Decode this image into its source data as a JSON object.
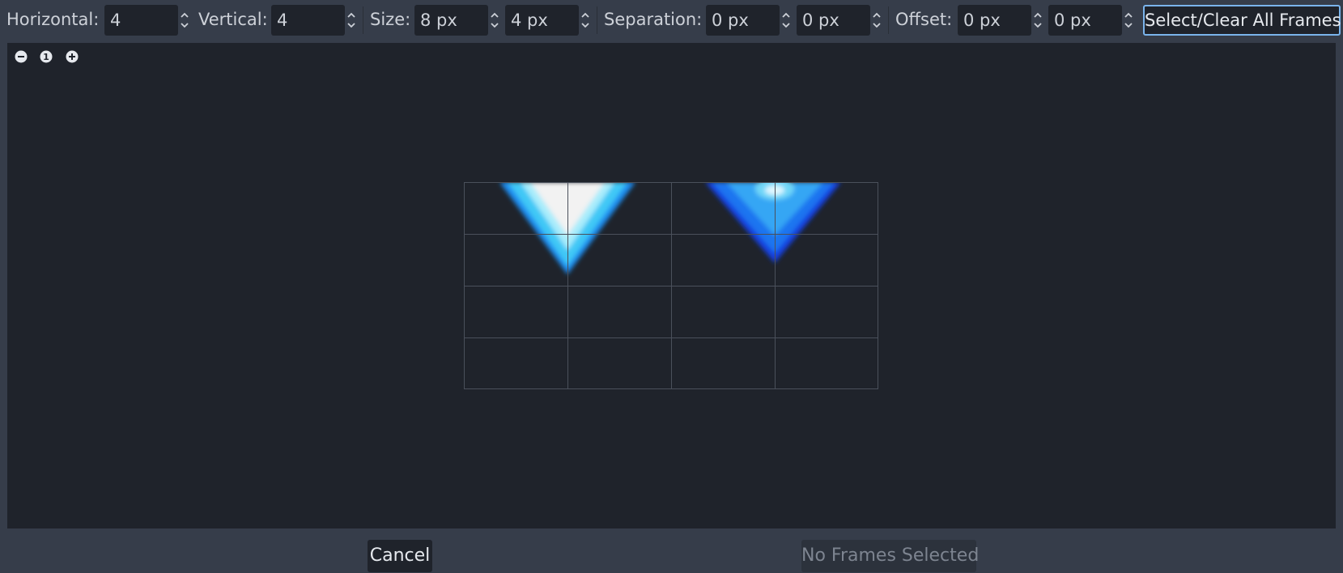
{
  "toolbar": {
    "horizontal_label": "Horizontal:",
    "horizontal_value": "4",
    "vertical_label": "Vertical:",
    "vertical_value": "4",
    "size_label": "Size:",
    "size_x_value": "8 px",
    "size_y_value": "4 px",
    "separation_label": "Separation:",
    "separation_x_value": "0 px",
    "separation_y_value": "0 px",
    "offset_label": "Offset:",
    "offset_x_value": "0 px",
    "offset_y_value": "0 px",
    "select_clear_label": "Select/Clear All Frames"
  },
  "zoom": {
    "zoom_out_icon": "zoom-out-icon",
    "zoom_reset_icon": "zoom-reset-icon",
    "zoom_reset_label": "1",
    "zoom_in_icon": "zoom-in-icon"
  },
  "grid": {
    "columns": 4,
    "rows": 4,
    "line_color": "#4a505b"
  },
  "footer": {
    "cancel_label": "Cancel",
    "confirm_label": "No Frames Selected"
  },
  "colors": {
    "accent": "#7ab4ec",
    "panel": "#1f232b",
    "background": "#363d4a"
  }
}
